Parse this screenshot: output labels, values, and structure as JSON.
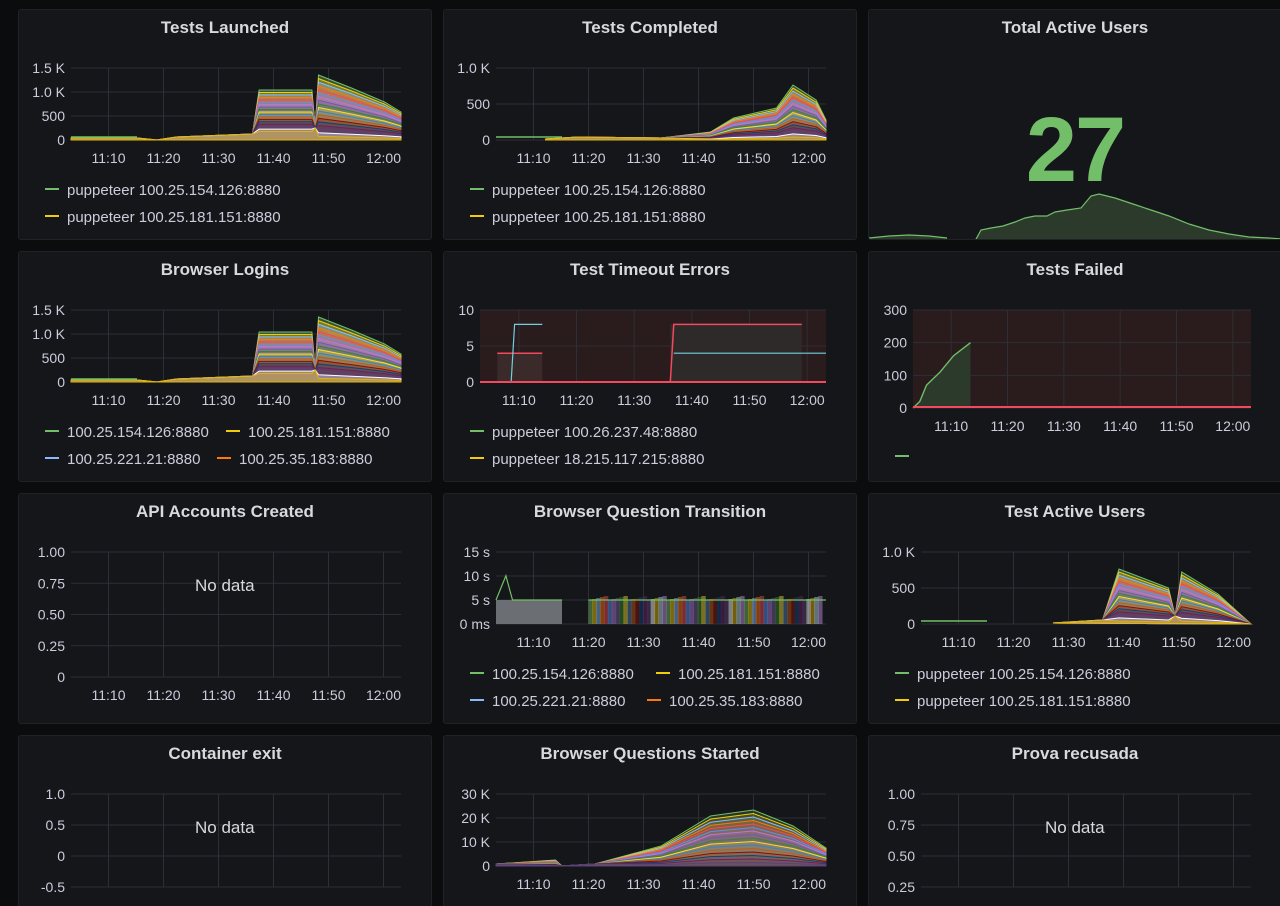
{
  "colors": {
    "green": "#73bf69",
    "yellow": "#f2cc0c",
    "blue": "#8ab8ff",
    "orange": "#ff780a",
    "red": "#f2495c",
    "cyan": "#6ed0e0"
  },
  "panels": {
    "tests_launched": {
      "title": "Tests Launched",
      "y_ticks": [
        "1.5 K",
        "1.0 K",
        "500",
        "0"
      ],
      "x_ticks": [
        "11:10",
        "11:20",
        "11:30",
        "11:40",
        "11:50",
        "12:00"
      ],
      "legend": [
        "puppeteer 100.25.154.126:8880",
        "puppeteer 100.25.181.151:8880"
      ]
    },
    "tests_completed": {
      "title": "Tests Completed",
      "y_ticks": [
        "1.0 K",
        "500",
        "0"
      ],
      "x_ticks": [
        "11:10",
        "11:20",
        "11:30",
        "11:40",
        "11:50",
        "12:00"
      ],
      "legend": [
        "puppeteer 100.25.154.126:8880",
        "puppeteer 100.25.181.151:8880"
      ]
    },
    "total_active_users": {
      "title": "Total Active Users",
      "value": "27"
    },
    "browser_logins": {
      "title": "Browser Logins",
      "y_ticks": [
        "1.5 K",
        "1.0 K",
        "500",
        "0"
      ],
      "x_ticks": [
        "11:10",
        "11:20",
        "11:30",
        "11:40",
        "11:50",
        "12:00"
      ],
      "legend": [
        "100.25.154.126:8880",
        "100.25.181.151:8880",
        "100.25.221.21:8880",
        "100.25.35.183:8880"
      ]
    },
    "test_timeout_errors": {
      "title": "Test Timeout Errors",
      "y_ticks": [
        "10",
        "5",
        "0"
      ],
      "x_ticks": [
        "11:10",
        "11:20",
        "11:30",
        "11:40",
        "11:50",
        "12:00"
      ],
      "legend": [
        "puppeteer 100.26.237.48:8880",
        "puppeteer 18.215.117.215:8880"
      ]
    },
    "tests_failed": {
      "title": "Tests Failed",
      "y_ticks": [
        "300",
        "200",
        "100",
        "0"
      ],
      "x_ticks": [
        "11:10",
        "11:20",
        "11:30",
        "11:40",
        "11:50",
        "12:00"
      ]
    },
    "api_accounts_created": {
      "title": "API Accounts Created",
      "y_ticks": [
        "1.00",
        "0.75",
        "0.50",
        "0.25",
        "0"
      ],
      "x_ticks": [
        "11:10",
        "11:20",
        "11:30",
        "11:40",
        "11:50",
        "12:00"
      ],
      "no_data": "No data"
    },
    "browser_question_transition": {
      "title": "Browser Question Transition",
      "y_ticks": [
        "15 s",
        "10 s",
        "5 s",
        "0 ms"
      ],
      "x_ticks": [
        "11:10",
        "11:20",
        "11:30",
        "11:40",
        "11:50",
        "12:00"
      ],
      "legend": [
        "100.25.154.126:8880",
        "100.25.181.151:8880",
        "100.25.221.21:8880",
        "100.25.35.183:8880"
      ]
    },
    "test_active_users": {
      "title": "Test Active Users",
      "y_ticks": [
        "1.0 K",
        "500",
        "0"
      ],
      "x_ticks": [
        "11:10",
        "11:20",
        "11:30",
        "11:40",
        "11:50",
        "12:00"
      ],
      "legend": [
        "puppeteer 100.25.154.126:8880",
        "puppeteer 100.25.181.151:8880"
      ]
    },
    "container_exit": {
      "title": "Container exit",
      "y_ticks": [
        "1.0",
        "0.5",
        "0",
        "-0.5"
      ],
      "no_data": "No data"
    },
    "browser_questions_started": {
      "title": "Browser Questions Started",
      "y_ticks": [
        "30 K",
        "20 K",
        "10 K",
        "0"
      ],
      "x_ticks": [
        "11:10",
        "11:20",
        "11:30",
        "11:40",
        "11:50",
        "12:00"
      ]
    },
    "prova_recusada": {
      "title": "Prova recusada",
      "y_ticks": [
        "1.00",
        "0.75",
        "0.50",
        "0.25"
      ],
      "no_data": "No data"
    }
  }
}
